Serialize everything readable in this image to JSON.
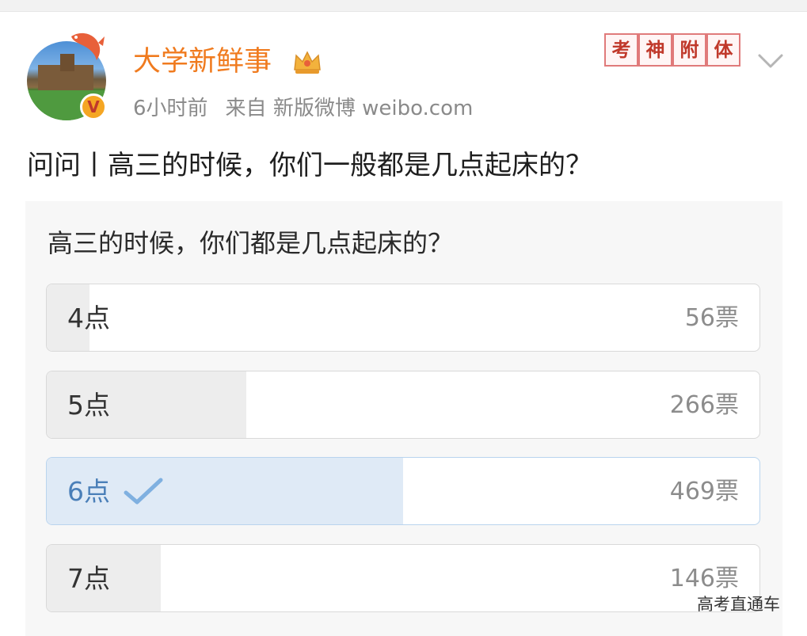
{
  "post": {
    "username": "大学新鲜事",
    "time": "6小时前",
    "source_prefix": "来自",
    "source": "新版微博 weibo.com",
    "text": "问问丨高三的时候，你们一般都是几点起床的？",
    "stamp_chars": [
      "考",
      "神",
      "附",
      "体"
    ],
    "verified_badge": "V"
  },
  "poll": {
    "question": "高三的时候，你们都是几点起床的？",
    "options": [
      {
        "label": "4点",
        "votes_text": "56票",
        "votes": 56,
        "fill_fraction": 0.06,
        "selected": false
      },
      {
        "label": "5点",
        "votes_text": "266票",
        "votes": 266,
        "fill_fraction": 0.28,
        "selected": false
      },
      {
        "label": "6点",
        "votes_text": "469票",
        "votes": 469,
        "fill_fraction": 0.5,
        "selected": true
      },
      {
        "label": "7点",
        "votes_text": "146票",
        "votes": 146,
        "fill_fraction": 0.16,
        "selected": false
      }
    ]
  },
  "watermark": "高考直通车",
  "colors": {
    "username": "#f07b1f",
    "selected_fill": "#dfeaf6",
    "selected_text": "#4a7fb8",
    "check": "#7fb0e0"
  },
  "icons": {
    "crown": "crown-icon",
    "chevron": "chevron-down-icon",
    "check": "check-icon",
    "fish": "koi-fish-icon"
  }
}
